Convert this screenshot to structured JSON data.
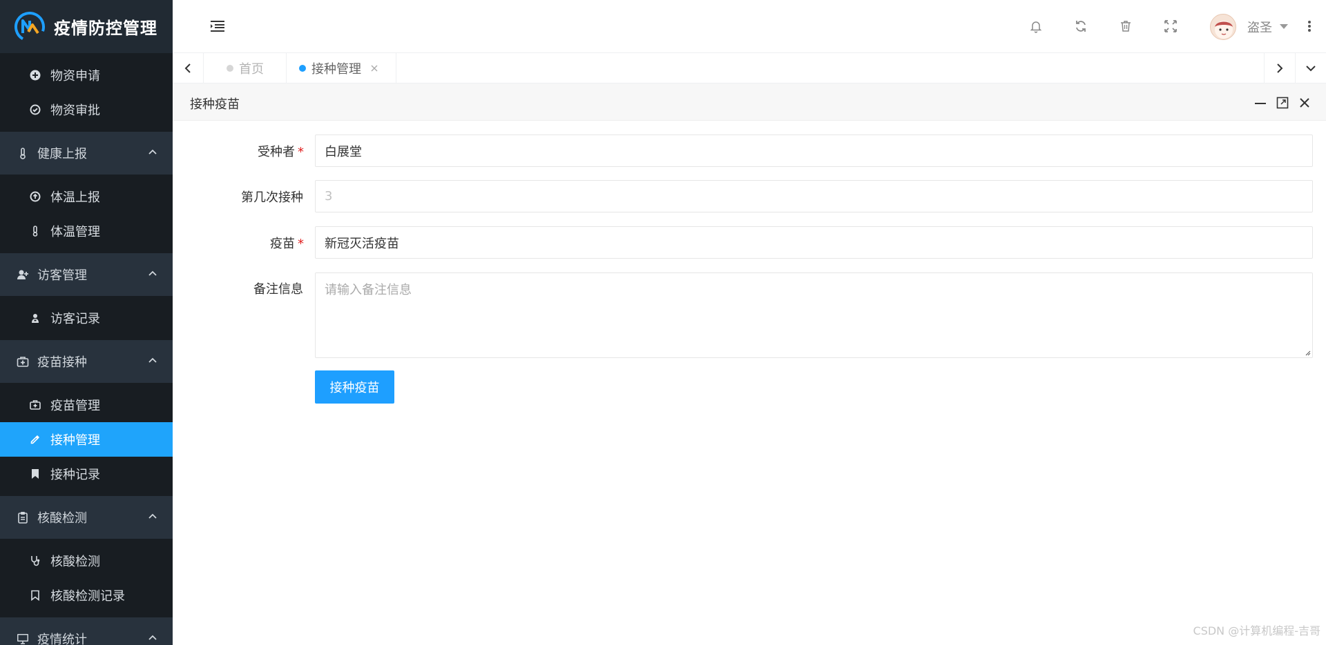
{
  "app": {
    "title": "疫情防控管理"
  },
  "sidebar": {
    "top_items": [
      {
        "label": "物资申请",
        "icon": "plus-circle-icon"
      },
      {
        "label": "物资审批",
        "icon": "check-circle-icon"
      }
    ],
    "groups": [
      {
        "label": "健康上报",
        "icon": "thermometer-icon",
        "items": [
          {
            "label": "体温上报",
            "icon": "upload-circle-icon"
          },
          {
            "label": "体温管理",
            "icon": "thermometer-icon"
          }
        ]
      },
      {
        "label": "访客管理",
        "icon": "user-plus-icon",
        "items": [
          {
            "label": "访客记录",
            "icon": "user-badge-icon"
          }
        ]
      },
      {
        "label": "疫苗接种",
        "icon": "medkit-icon",
        "items": [
          {
            "label": "疫苗管理",
            "icon": "medkit-icon"
          },
          {
            "label": "接种管理",
            "icon": "eyedropper-icon",
            "active": true
          },
          {
            "label": "接种记录",
            "icon": "bookmark-icon"
          }
        ]
      },
      {
        "label": "核酸检测",
        "icon": "clipboard-icon",
        "items": [
          {
            "label": "核酸检测",
            "icon": "stethoscope-icon"
          },
          {
            "label": "核酸检测记录",
            "icon": "bookmark-outline-icon"
          }
        ]
      },
      {
        "label": "疫情统计",
        "icon": "monitor-icon",
        "items": []
      }
    ]
  },
  "header": {
    "icons": [
      "menu-fold-icon",
      "bell-icon",
      "refresh-icon",
      "trash-icon",
      "fullscreen-icon",
      "more-vertical-icon"
    ],
    "user_name": "盗圣"
  },
  "tabs": [
    {
      "label": "首页",
      "active": false
    },
    {
      "label": "接种管理",
      "active": true,
      "closable": true
    }
  ],
  "panel": {
    "title": "接种疫苗"
  },
  "form": {
    "recipient": {
      "label": "受种者",
      "required": true,
      "value": "白展堂"
    },
    "dose_number": {
      "label": "第几次接种",
      "required": false,
      "value": "3"
    },
    "vaccine": {
      "label": "疫苗",
      "required": true,
      "value": "新冠灭活疫苗"
    },
    "remarks": {
      "label": "备注信息",
      "placeholder": "请输入备注信息",
      "value": ""
    },
    "submit_label": "接种疫苗"
  },
  "watermark": "CSDN @计算机编程-吉哥",
  "colors": {
    "sidebar_bg": "#181d22",
    "sidebar_group_bg": "#28323d",
    "logo_bg": "#212a33",
    "accent": "#1e9fff",
    "active_item": "#1fa4fb",
    "required": "#e02020"
  }
}
